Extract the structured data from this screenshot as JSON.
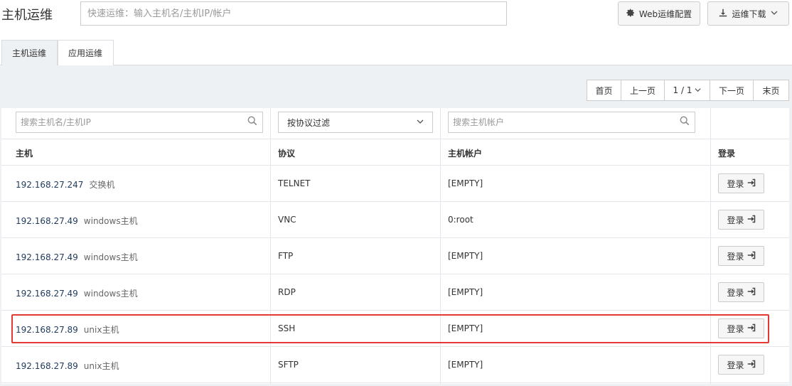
{
  "header": {
    "title": "主机运维",
    "quick_search_placeholder": "快速运维：输入主机名/主机IP/帐户",
    "web_config_label": "Web运维配置",
    "download_label": "运维下载"
  },
  "tabs": [
    {
      "label": "主机运维",
      "active": true
    },
    {
      "label": "应用运维",
      "active": false
    }
  ],
  "pager": {
    "first": "首页",
    "prev": "上一页",
    "page": "1 / 1",
    "next": "下一页",
    "last": "末页"
  },
  "filters": {
    "host_placeholder": "搜索主机名/主机IP",
    "protocol_select": "按协议过滤",
    "account_placeholder": "搜索主机帐户"
  },
  "columns": [
    "主机",
    "协议",
    "主机帐户",
    "登录"
  ],
  "login_label": "登录",
  "rows": [
    {
      "ip": "192.168.27.247",
      "name": "交换机",
      "protocol": "TELNET",
      "account": "[EMPTY]"
    },
    {
      "ip": "192.168.27.49",
      "name": "windows主机",
      "protocol": "VNC",
      "account": "0:root"
    },
    {
      "ip": "192.168.27.49",
      "name": "windows主机",
      "protocol": "FTP",
      "account": "[EMPTY]"
    },
    {
      "ip": "192.168.27.49",
      "name": "windows主机",
      "protocol": "RDP",
      "account": "[EMPTY]"
    },
    {
      "ip": "192.168.27.89",
      "name": "unix主机",
      "protocol": "SSH",
      "account": "[EMPTY]"
    },
    {
      "ip": "192.168.27.89",
      "name": "unix主机",
      "protocol": "SFTP",
      "account": "[EMPTY]"
    }
  ],
  "highlighted_row_index": 4,
  "colors": {
    "highlight": "#e53935",
    "content_background": "#eef1f4",
    "ip_text": "#1f3a5c"
  },
  "icons": {
    "web_config": "gear-icon",
    "download": "download-icon",
    "download_chevron": "chevron-down-icon",
    "filter_search": "search-icon",
    "select_chevron": "chevron-down-icon",
    "login": "sign-in-icon"
  }
}
